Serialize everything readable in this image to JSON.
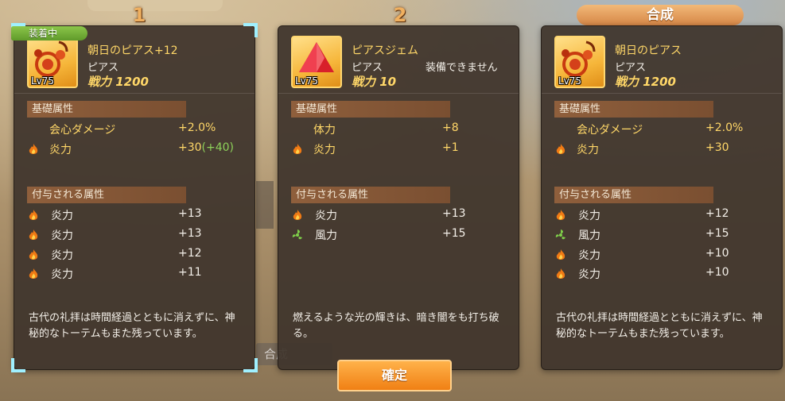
{
  "headers": {
    "slot1": "1",
    "slot2": "2",
    "result": "合成"
  },
  "cards": [
    {
      "equip_tag": "装着中",
      "name": "朝日のピアス+12",
      "type": "ピアス",
      "power": "戦力 1200",
      "level": "Lv75",
      "plus_badge": "+12",
      "sections": {
        "base": "基礎属性",
        "extra": "付与される属性"
      },
      "base": [
        {
          "label": "会心ダメージ",
          "value": "+2.0%",
          "icon": ""
        },
        {
          "label": "炎力",
          "value": "+30",
          "bonus": "(+40)",
          "icon": "fire-icon"
        }
      ],
      "extra": [
        {
          "label": "炎力",
          "value": "+13",
          "icon": "fire-icon"
        },
        {
          "label": "炎力",
          "value": "+13",
          "icon": "fire-icon"
        },
        {
          "label": "炎力",
          "value": "+12",
          "icon": "fire-icon"
        },
        {
          "label": "炎力",
          "value": "+11",
          "icon": "fire-icon"
        }
      ],
      "description": "古代の礼拝は時間経過とともに消えずに、神秘的なトーテムもまた残っています。"
    },
    {
      "name": "ピアスジェム",
      "type": "ピアス",
      "cannot_equip": "装備できません",
      "power": "戦力 10",
      "level": "Lv75",
      "sections": {
        "base": "基礎属性",
        "extra": "付与される属性"
      },
      "base": [
        {
          "label": "体力",
          "value": "+8",
          "icon": ""
        },
        {
          "label": "炎力",
          "value": "+1",
          "icon": "fire-icon"
        }
      ],
      "extra": [
        {
          "label": "炎力",
          "value": "+13",
          "icon": "fire-icon"
        },
        {
          "label": "風力",
          "value": "+15",
          "icon": "wind-icon"
        }
      ],
      "description": "燃えるような光の輝きは、暗き闇をも打ち破る。"
    },
    {
      "name": "朝日のピアス",
      "type": "ピアス",
      "power": "戦力 1200",
      "level": "Lv75",
      "sections": {
        "base": "基礎属性",
        "extra": "付与される属性"
      },
      "base": [
        {
          "label": "会心ダメージ",
          "value": "+2.0%",
          "icon": ""
        },
        {
          "label": "炎力",
          "value": "+30",
          "icon": "fire-icon"
        }
      ],
      "extra": [
        {
          "label": "炎力",
          "value": "+12",
          "icon": "fire-icon"
        },
        {
          "label": "風力",
          "value": "+15",
          "icon": "wind-icon"
        },
        {
          "label": "炎力",
          "value": "+10",
          "icon": "fire-icon"
        },
        {
          "label": "炎力",
          "value": "+10",
          "icon": "fire-icon"
        }
      ],
      "description": "古代の礼拝は時間経過とともに消えずに、神秘的なトーテムもまた残っています。"
    }
  ],
  "background": {
    "under_button": "合成"
  },
  "confirm_label": "確定",
  "colors": {
    "accent": "#f08014",
    "gold": "#ffd768",
    "bonus": "#8ed15a",
    "panel": "#40352d"
  }
}
